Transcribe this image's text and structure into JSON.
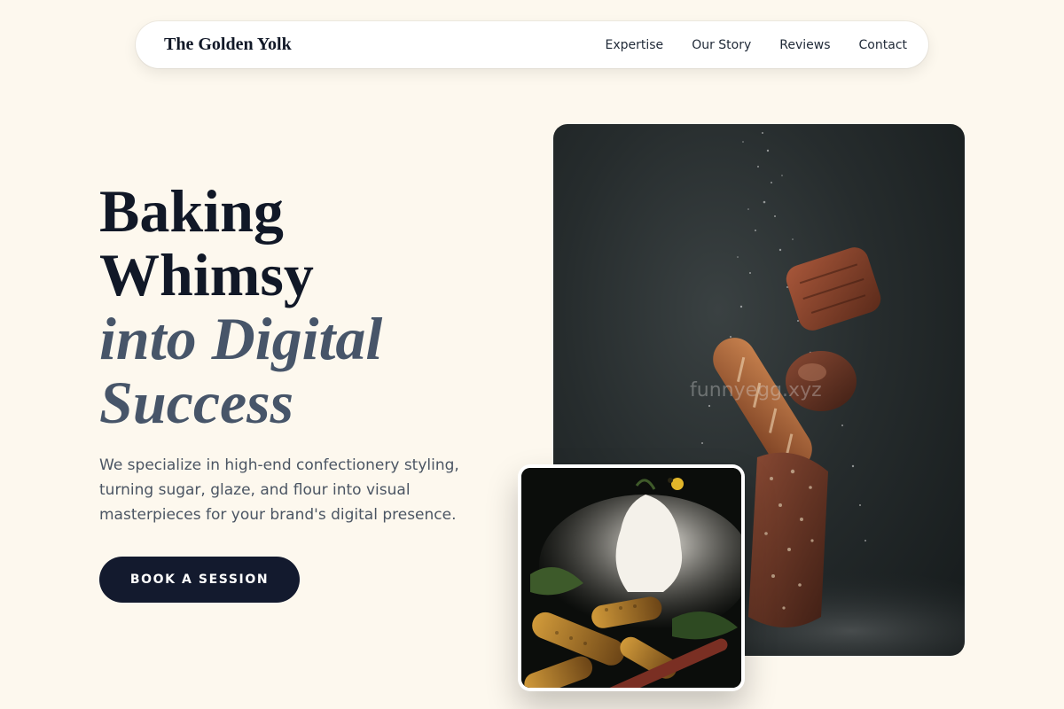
{
  "nav": {
    "brand": "The Golden Yolk",
    "links": [
      "Expertise",
      "Our Story",
      "Reviews",
      "Contact"
    ]
  },
  "hero": {
    "headline_lines": [
      "Baking",
      "Whimsy"
    ],
    "headline_italic_lines": [
      "into Digital",
      "Success"
    ],
    "lead": "We specialize in high-end confectionery styling, turning sugar, glaze, and flour into visual masterpieces for your brand's digital presence.",
    "cta_label": "BOOK A SESSION"
  },
  "images": {
    "main_watermark": "funnyegg.xyz",
    "main_icon": "floating-bread-photo",
    "secondary_icon": "roasted-corn-photo"
  },
  "colors": {
    "background": "#fdf8ee",
    "primary_dark": "#131a2e",
    "italic_accent": "#475569"
  }
}
